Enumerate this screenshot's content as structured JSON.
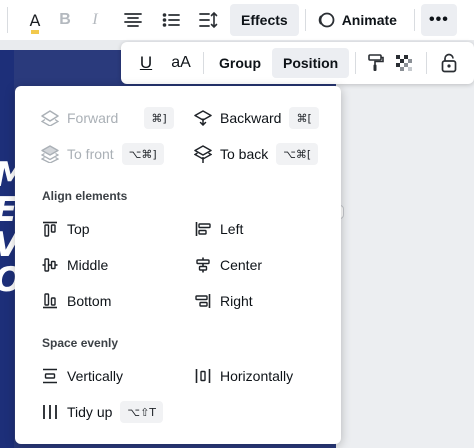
{
  "toolbar": {
    "effects_label": "Effects",
    "animate_label": "Animate",
    "more_label": "•••",
    "text_color_glyph": "A",
    "bold_glyph": "B",
    "italic_glyph": "I",
    "text_color_bar": "#f2c94c"
  },
  "toolbar2": {
    "underline_glyph": "U",
    "case_glyph": "aA",
    "group_label": "Group",
    "position_label": "Position"
  },
  "menu": {
    "forward": {
      "label": "Forward",
      "shortcut": "⌘]"
    },
    "backward": {
      "label": "Backward",
      "shortcut": "⌘["
    },
    "to_front": {
      "label": "To front",
      "shortcut": "⌥⌘]"
    },
    "to_back": {
      "label": "To back",
      "shortcut": "⌥⌘["
    },
    "align_heading": "Align elements",
    "top": "Top",
    "left": "Left",
    "middle": "Middle",
    "center": "Center",
    "bottom": "Bottom",
    "right": "Right",
    "space_heading": "Space evenly",
    "vertically": "Vertically",
    "horizontally": "Horizontally",
    "tidy_up": {
      "label": "Tidy up",
      "shortcut": "⌥⇧T"
    }
  },
  "canvas": {
    "letters": [
      "M",
      "E",
      "V",
      "O"
    ],
    "colors": {
      "background": "#2a3a7c",
      "accent": "#f2c94c"
    }
  }
}
